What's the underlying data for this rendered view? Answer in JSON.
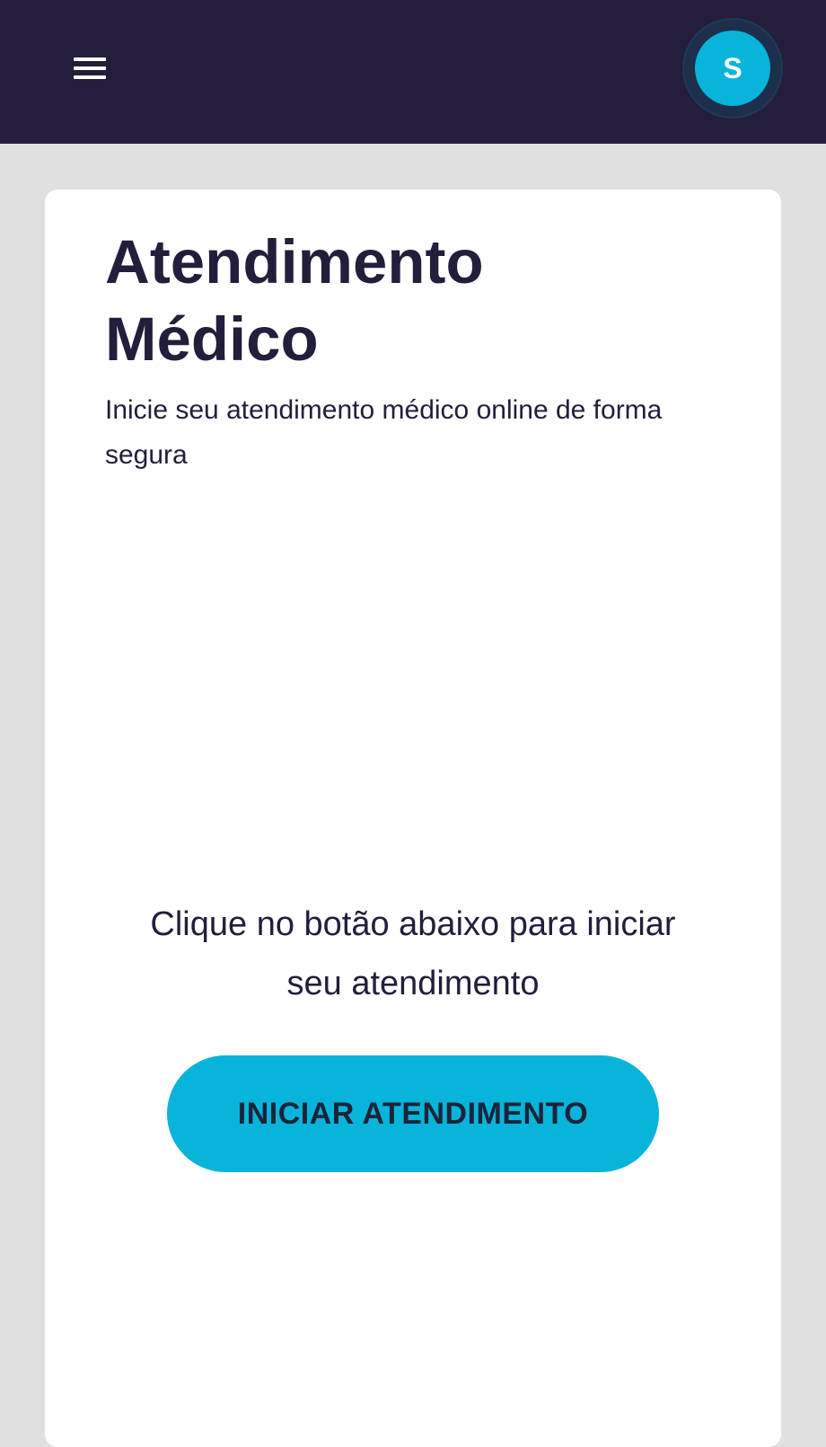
{
  "header": {
    "menu_icon": "hamburger-menu-icon",
    "avatar_initial": "S",
    "background_color": "#241d3b",
    "avatar_color": "#08b4d9"
  },
  "main": {
    "title": "Atendimento Médico",
    "subtitle": "Inicie seu atendimento médico online de forma segura",
    "instruction": "Clique no botão abaixo para iniciar seu atendimento",
    "start_button_label": "INICIAR ATENDIMENTO",
    "accent_color": "#08b4d9",
    "text_color": "#241d3b"
  }
}
